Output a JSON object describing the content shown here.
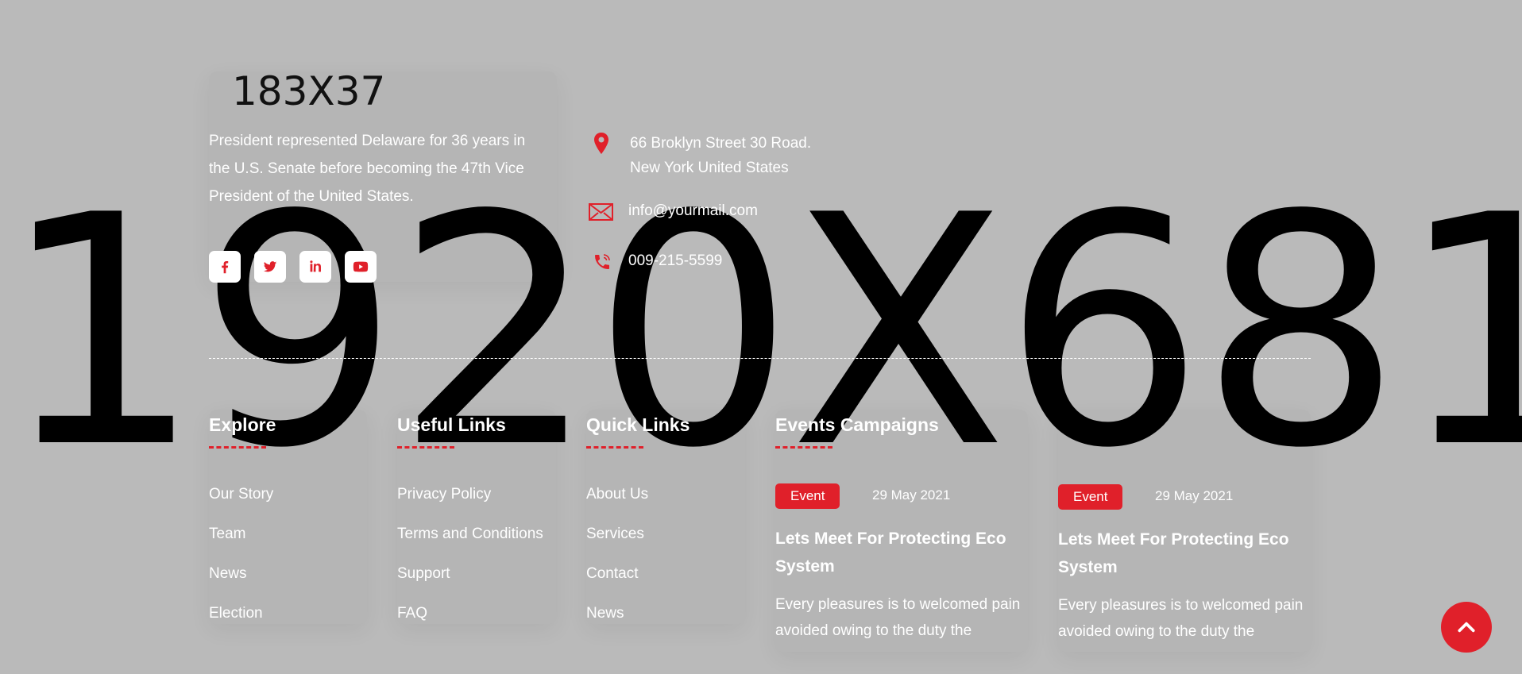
{
  "background": {
    "placeholder_text": "1920X681"
  },
  "about": {
    "logo_text": "183X37",
    "description": "President represented Delaware for 36 years in the U.S. Senate before becoming the 47th Vice President of the United States.",
    "socials": [
      {
        "icon": "facebook-icon"
      },
      {
        "icon": "twitter-icon"
      },
      {
        "icon": "linkedin-icon"
      },
      {
        "icon": "youtube-icon"
      }
    ]
  },
  "contact": {
    "address_line1": "66 Broklyn Street 30 Road.",
    "address_line2": "New York United States",
    "email": "info@yourmail.com",
    "phone": "009-215-5599"
  },
  "columns": {
    "explore": {
      "title": "Explore",
      "links": [
        "Our Story",
        "Team",
        "News",
        "Election"
      ]
    },
    "useful": {
      "title": "Useful Links",
      "links": [
        "Privacy Policy",
        "Terms and Conditions",
        "Support",
        "FAQ"
      ]
    },
    "quick": {
      "title": "Quick Links",
      "links": [
        "About Us",
        "Services",
        "Contact",
        "News"
      ]
    },
    "events": {
      "title": "Events Campaigns",
      "items": [
        {
          "badge": "Event",
          "date": "29 May 2021",
          "title": "Lets Meet For Protecting Eco System",
          "description": "Every pleasures is to welcomed pain avoided owing to the duty the"
        },
        {
          "badge": "Event",
          "date": "29 May 2021",
          "title": "Lets Meet For Protecting Eco System",
          "description": "Every pleasures is to welcomed pain avoided owing to the duty the"
        }
      ]
    }
  },
  "colors": {
    "accent": "#e0202a",
    "background": "#bababa",
    "text": "#ffffff"
  },
  "scroll_top": {
    "icon": "chevron-up-icon"
  }
}
